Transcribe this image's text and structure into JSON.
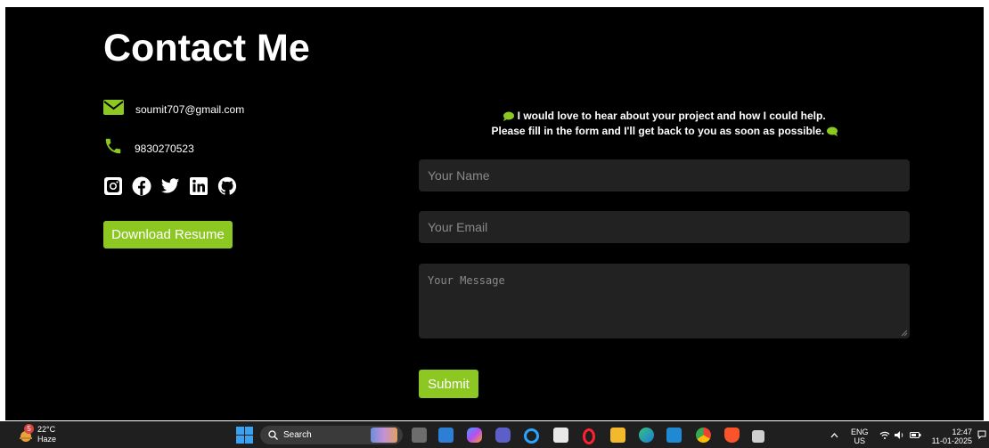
{
  "contact": {
    "title": "Contact Me",
    "email": "soumit707@gmail.com",
    "phone": "9830270523",
    "resume_label": "Download Resume",
    "social_icons": [
      "instagram-icon",
      "facebook-icon",
      "twitter-icon",
      "linkedin-icon",
      "github-icon"
    ]
  },
  "form": {
    "intro_line1": "I would love to hear about your project and how I could help.",
    "intro_line2": "Please fill in the form and I'll get back to you as soon as possible.",
    "name_placeholder": "Your Name",
    "email_placeholder": "Your Email",
    "message_placeholder": "Your Message",
    "submit_label": "Submit"
  },
  "taskbar": {
    "weather_temp": "22°C",
    "weather_desc": "Haze",
    "weather_badge": "5",
    "search_label": "Search",
    "lang_line1": "ENG",
    "lang_line2": "US",
    "time": "12:47",
    "date": "11-01-2025"
  },
  "colors": {
    "accent": "#8cc722",
    "background": "#000000",
    "field": "#222222"
  }
}
